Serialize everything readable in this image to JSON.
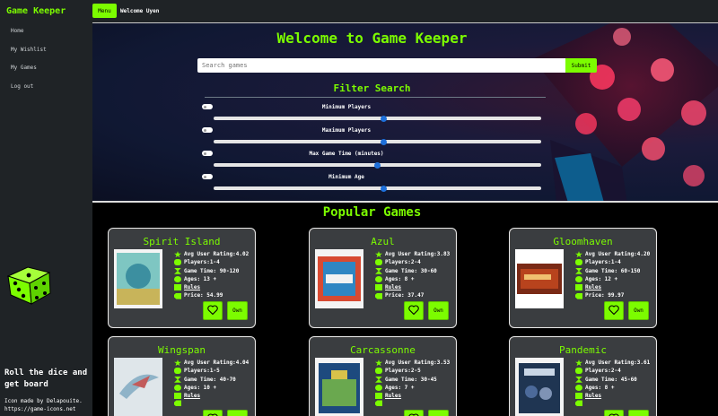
{
  "brand": "Game Keeper",
  "nav": [
    "Home",
    "My Wishlist",
    "My Games",
    "Log out"
  ],
  "tagline": "Roll the dice and get board",
  "credit": "Icon made by Delapouite. https://game-icons.net",
  "topbar": {
    "menu_label": "Menu",
    "welcome_text": "Welcome Uyen"
  },
  "hero": {
    "title": "Welcome to Game Keeper",
    "search_placeholder": "Search games",
    "submit_label": "Submit",
    "filter_title": "Filter Search",
    "filters": [
      {
        "label": "Minimum Players",
        "level": 0.52
      },
      {
        "label": "Maximum Players",
        "level": 0.52
      },
      {
        "label": "Max Game Time (minutes)",
        "level": 0.5
      },
      {
        "label": "Minimum Age",
        "level": 0.52
      }
    ]
  },
  "popular": {
    "title": "Popular Games",
    "games": [
      {
        "name": "Spirit Island",
        "rating": "Avg User Rating:4.02",
        "players": "Players:1-4",
        "time": "Game Time: 90-120",
        "ages": "Ages: 13 +",
        "rules": "Rules",
        "price": "Price: 54.99",
        "own": "Own"
      },
      {
        "name": "Azul",
        "rating": "Avg User Rating:3.83",
        "players": "Players:2-4",
        "time": "Game Time: 30-60",
        "ages": "Ages: 8 +",
        "rules": "Rules",
        "price": "Price: 37.47",
        "own": "Own"
      },
      {
        "name": "Gloomhaven",
        "rating": "Avg User Rating:4.20",
        "players": "Players:1-4",
        "time": "Game Time: 60-150",
        "ages": "Ages: 12 +",
        "rules": "Rules",
        "price": "Price: 99.97",
        "own": "Own"
      },
      {
        "name": "Wingspan",
        "rating": "Avg User Rating:4.04",
        "players": "Players:1-5",
        "time": "Game Time: 40-70",
        "ages": "Ages: 10 +",
        "rules": "Rules",
        "price": "",
        "own": ""
      },
      {
        "name": "Carcassonne",
        "rating": "Avg User Rating:3.53",
        "players": "Players:2-5",
        "time": "Game Time: 30-45",
        "ages": "Ages: 7 +",
        "rules": "Rules",
        "price": "",
        "own": ""
      },
      {
        "name": "Pandemic",
        "rating": "Avg User Rating:3.61",
        "players": "Players:2-4",
        "time": "Game Time: 45-60",
        "ages": "Ages: 8 +",
        "rules": "Rules",
        "price": "",
        "own": ""
      }
    ]
  },
  "colors": {
    "accent": "#7cfc00",
    "sidebar": "#1f2326",
    "card": "#3a3d40"
  },
  "icons": {
    "dice": "dice-icon",
    "star": "star-icon",
    "players": "players-icon",
    "hourglass": "hourglass-icon",
    "book": "book-icon",
    "price": "price-tag-icon",
    "heart": "heart-icon"
  }
}
